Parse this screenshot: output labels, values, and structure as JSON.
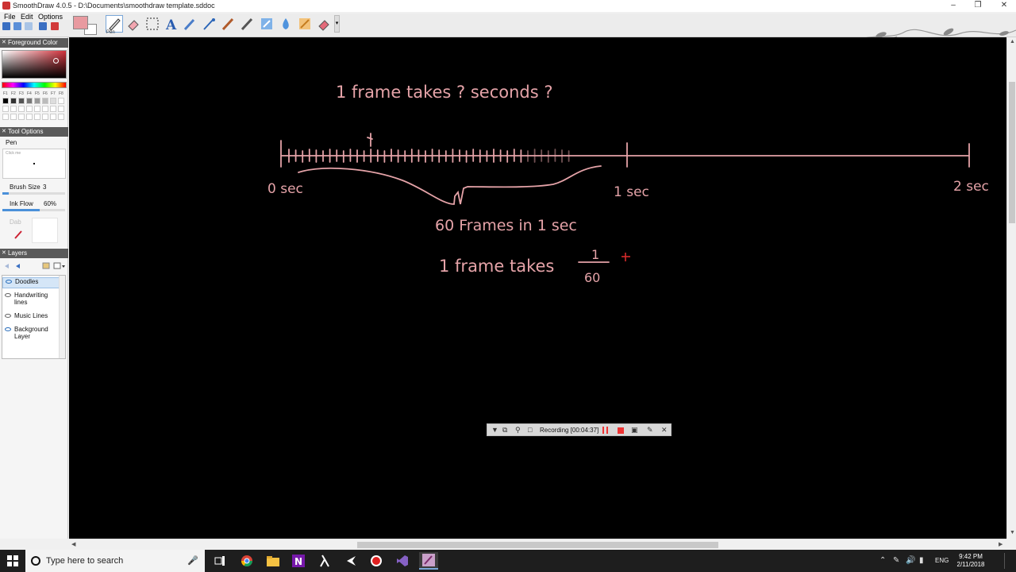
{
  "window": {
    "title": "SmoothDraw 4.0.5 - D:\\Documents\\smoothdraw template.sddoc",
    "minimize": "–",
    "maximize": "❐",
    "close": "✕"
  },
  "menu": [
    "File",
    "Edit",
    "Options"
  ],
  "toolbar": {
    "active_tool_label": "Pen",
    "tools": [
      "pen-icon",
      "eraser-icon",
      "selection-icon",
      "text-icon",
      "brush-icon",
      "airbrush-icon",
      "pencil-icon",
      "blur-icon",
      "water-icon",
      "smudge-icon",
      "highlighter-icon"
    ],
    "more": "▾",
    "foreground_color": "#e89aa0",
    "background_color": "#ffffff"
  },
  "panels": {
    "foreground_header": "Foreground Color",
    "fkeys": [
      "F1",
      "F2",
      "F3",
      "F4",
      "F5",
      "F6",
      "F7",
      "F8"
    ],
    "palette": [
      "#000000",
      "#333333",
      "#555555",
      "#777777",
      "#999999",
      "#bbbbbb",
      "#dddddd",
      "#ffffff"
    ],
    "tool_options_header": "Tool Options",
    "tool_name": "Pen",
    "preview_hint": "Click me",
    "brush_size_label": "Brush Size",
    "brush_size_value": "3",
    "brush_size_level": 0.1,
    "ink_flow_label": "Ink Flow",
    "ink_flow_value": "60%",
    "ink_flow_level": 0.6,
    "dab_label": "Dab",
    "layers_header": "Layers",
    "layers": [
      {
        "name": "Doodles",
        "selected": true
      },
      {
        "name": "Handwriting lines",
        "selected": false
      },
      {
        "name": "Music Lines",
        "selected": false
      },
      {
        "name": "Background Layer",
        "selected": false
      }
    ]
  },
  "canvas": {
    "question": "1 frame takes ? seconds ?",
    "label_0": "0 sec",
    "label_1": "1 sec",
    "label_2": "2 sec",
    "frames_note": "60 Frames in 1 sec",
    "answer_prefix": "1 frame takes",
    "numerator": "1",
    "denominator": "60",
    "ink_color": "#e5a3a8"
  },
  "recording": {
    "text": "Recording [00:04:37]"
  },
  "taskbar": {
    "search_placeholder": "Type here to search",
    "language": "ENG",
    "time": "9:42 PM",
    "date": "2/11/2018",
    "apps": [
      "task-view-icon",
      "chrome-icon",
      "file-explorer-icon",
      "onenote-icon",
      "app-lambda-icon",
      "app-media-icon",
      "record-app-icon",
      "visual-studio-icon",
      "smoothdraw-icon"
    ]
  }
}
